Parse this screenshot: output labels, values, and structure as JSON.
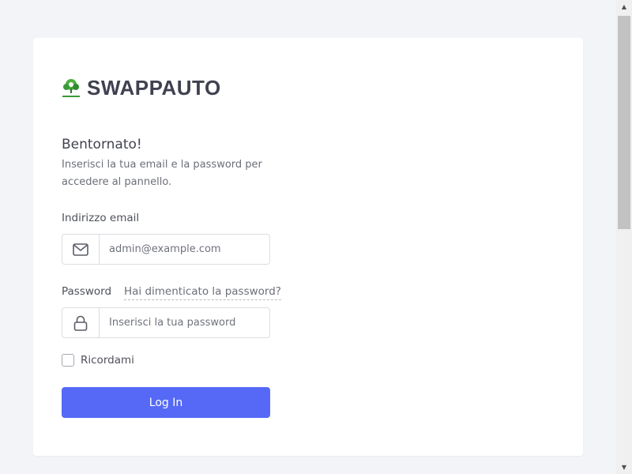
{
  "brand": {
    "name": "SWAPPAUTO",
    "logo_icon": "tree-logo-icon",
    "logo_text": "SWAPPAUTO"
  },
  "login": {
    "welcome": "Bentornato!",
    "subtitle": "Inserisci la tua email e la password per accedere al pannello.",
    "email_label": "Indirizzo email",
    "email_placeholder": "admin@example.com",
    "email_icon": "envelope-icon",
    "password_label": "Password",
    "forgot_link": "Hai dimenticato la password?",
    "password_placeholder": "Inserisci la tua password",
    "password_icon": "lock-icon",
    "remember_label": "Ricordami",
    "submit_label": "Log In"
  },
  "colors": {
    "accent": "#5569f6",
    "background": "#f3f4f7",
    "card": "#ffffff",
    "logo_green": "#3a9a3a"
  }
}
